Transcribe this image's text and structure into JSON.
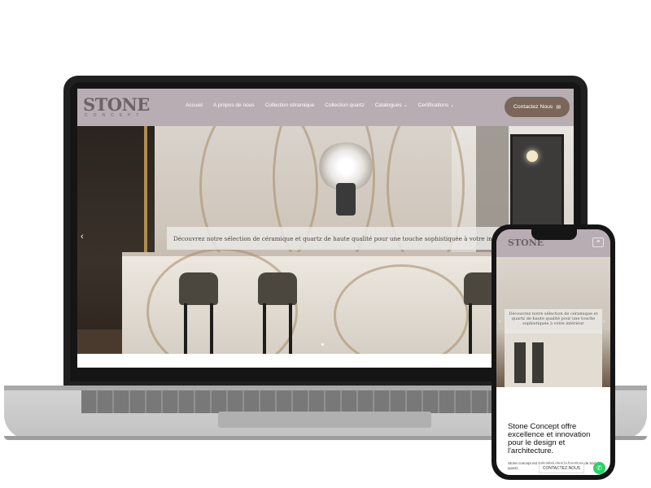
{
  "desktop": {
    "logo": {
      "main": "STONE",
      "sub": "CONCEPT"
    },
    "nav_items": [
      {
        "label": "Accueil"
      },
      {
        "label": "A propos de nous"
      },
      {
        "label": "Collection céramique"
      },
      {
        "label": "Collection quartz"
      },
      {
        "label": "Catalogues",
        "dropdown": true
      },
      {
        "label": "Certifications",
        "dropdown": true
      }
    ],
    "contact_button": "Contactez Nous",
    "hero_caption": "Découvrez notre sélection de céramique et quartz de haute qualité pour une touche sophistiquée à votre int",
    "slider_dots": 3
  },
  "mobile": {
    "logo": "STONE",
    "hero_caption": "Découvrez notre sélection de céramique et quartz de haute qualité pour une touche sophistiquée à votre intérieur",
    "heading": "Stone Concept offre excellence et innovation pour le design et l'architecture.",
    "body_text": "Stone concept est spécialisé dans la fourniture de transfor quartz,",
    "contact_button": "CONTACTEZ-NOUS"
  },
  "icons": {
    "slider_prev": "chevron-left-icon",
    "mail": "mail-icon",
    "whatsapp": "whatsapp-icon",
    "menu": "hamburger-icon"
  },
  "colors": {
    "header_bg": "#b8adb3",
    "button_bg": "#7a6759",
    "whatsapp": "#25d366"
  }
}
